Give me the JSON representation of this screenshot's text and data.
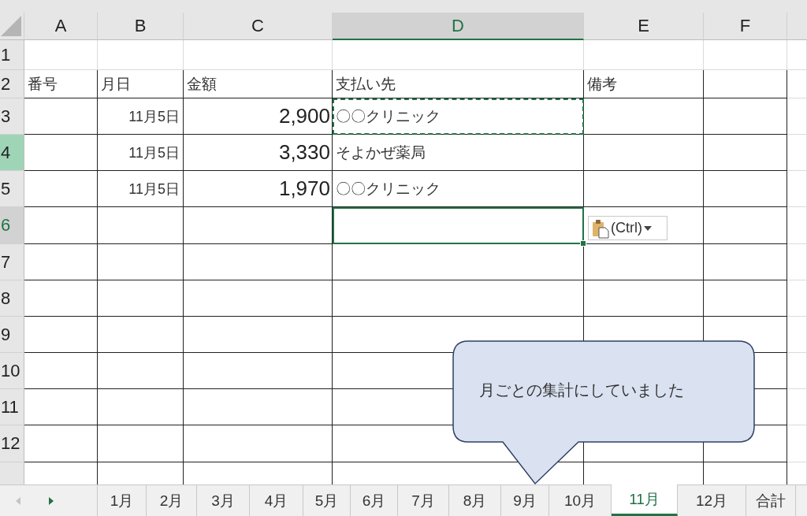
{
  "columns": [
    {
      "label": "A",
      "selected": false
    },
    {
      "label": "B",
      "selected": false
    },
    {
      "label": "C",
      "selected": false
    },
    {
      "label": "D",
      "selected": true
    },
    {
      "label": "E",
      "selected": false
    },
    {
      "label": "F",
      "selected": false
    }
  ],
  "rows": [
    {
      "label": "1",
      "selected": false,
      "in_selection": false,
      "boxed": false,
      "cells": {}
    },
    {
      "label": "2",
      "selected": false,
      "in_selection": false,
      "boxed": true,
      "cells": {
        "a": {
          "text": "番号"
        },
        "b": {
          "text": "月日"
        },
        "c": {
          "text": "金額"
        },
        "d": {
          "text": "支払い先"
        },
        "e": {
          "text": "備考"
        }
      }
    },
    {
      "label": "3",
      "selected": false,
      "in_selection": false,
      "boxed": true,
      "cells": {
        "b": {
          "text": "11月5日",
          "kind": "date"
        },
        "c": {
          "text": "2,900",
          "kind": "amount"
        },
        "d": {
          "text": "〇〇クリニック",
          "copied": true
        }
      }
    },
    {
      "label": "4",
      "selected": true,
      "in_selection": false,
      "boxed": true,
      "cells": {
        "b": {
          "text": "11月5日",
          "kind": "date"
        },
        "c": {
          "text": "3,330",
          "kind": "amount"
        },
        "d": {
          "text": "そよかぜ薬局"
        }
      }
    },
    {
      "label": "5",
      "selected": false,
      "in_selection": false,
      "boxed": true,
      "cells": {
        "b": {
          "text": "11月5日",
          "kind": "date"
        },
        "c": {
          "text": "1,970",
          "kind": "amount"
        },
        "d": {
          "text": "〇〇クリニック"
        }
      }
    },
    {
      "label": "6",
      "selected": false,
      "in_selection": true,
      "boxed": true,
      "cells": {
        "d": {
          "selected": true
        }
      }
    },
    {
      "label": "7",
      "selected": false,
      "in_selection": false,
      "boxed": true,
      "cells": {}
    },
    {
      "label": "8",
      "selected": false,
      "in_selection": false,
      "boxed": true,
      "cells": {}
    },
    {
      "label": "9",
      "selected": false,
      "in_selection": false,
      "boxed": true,
      "cells": {}
    },
    {
      "label": "10",
      "selected": false,
      "in_selection": false,
      "boxed": true,
      "cells": {}
    },
    {
      "label": "11",
      "selected": false,
      "in_selection": false,
      "boxed": true,
      "cells": {}
    },
    {
      "label": "12",
      "selected": false,
      "in_selection": false,
      "boxed": true,
      "cells": {}
    },
    {
      "selected": false,
      "in_selection": false,
      "boxed": true,
      "cells": {}
    }
  ],
  "paste_options": {
    "label": "(Ctrl)"
  },
  "callout": {
    "text": "月ごとの集計にしていました"
  },
  "sheet_tabs": [
    {
      "label": "1月",
      "selected": false
    },
    {
      "label": "2月",
      "selected": false
    },
    {
      "label": "3月",
      "selected": false
    },
    {
      "label": "4月",
      "selected": false
    },
    {
      "label": "5月",
      "selected": false
    },
    {
      "label": "6月",
      "selected": false
    },
    {
      "label": "7月",
      "selected": false
    },
    {
      "label": "8月",
      "selected": false
    },
    {
      "label": "9月",
      "selected": false
    },
    {
      "label": "10月",
      "selected": false
    },
    {
      "label": "11月",
      "selected": true
    },
    {
      "label": "12月",
      "selected": false
    },
    {
      "label": "合計",
      "selected": false
    }
  ]
}
